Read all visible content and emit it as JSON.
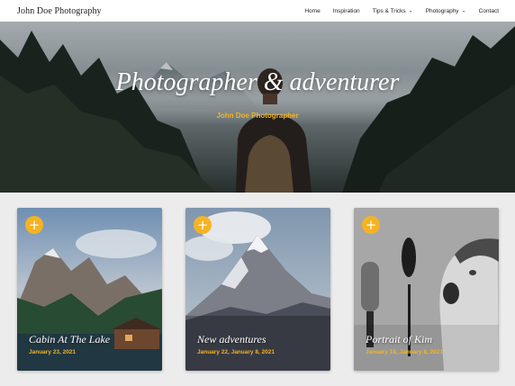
{
  "site": {
    "brand": "John Doe Photography"
  },
  "nav": {
    "items": [
      {
        "label": "Home",
        "dropdown": false
      },
      {
        "label": "Inspiration",
        "dropdown": false
      },
      {
        "label": "Tips & Tricks",
        "dropdown": true
      },
      {
        "label": "Photography",
        "dropdown": true
      },
      {
        "label": "Contact",
        "dropdown": false
      }
    ],
    "chevron_glyph": "⌄"
  },
  "hero": {
    "title": "Photographer & adventurer",
    "subtitle": "John Doe Photographer"
  },
  "cards": [
    {
      "title": "Cabin At The Lake",
      "date": "January 23, 2021",
      "plus": "+"
    },
    {
      "title": "New adventures",
      "date": "January 22, January 8, 2021",
      "plus": "+"
    },
    {
      "title": "Portrait of Kim",
      "date": "January 18, January 8, 2021",
      "plus": "+"
    }
  ],
  "colors": {
    "accent": "#f5b324",
    "header_bg": "#ffffff",
    "page_bg": "#ececec"
  },
  "icons": {
    "plus_button": "plus-icon",
    "dropdown": "chevron-down-icon"
  }
}
